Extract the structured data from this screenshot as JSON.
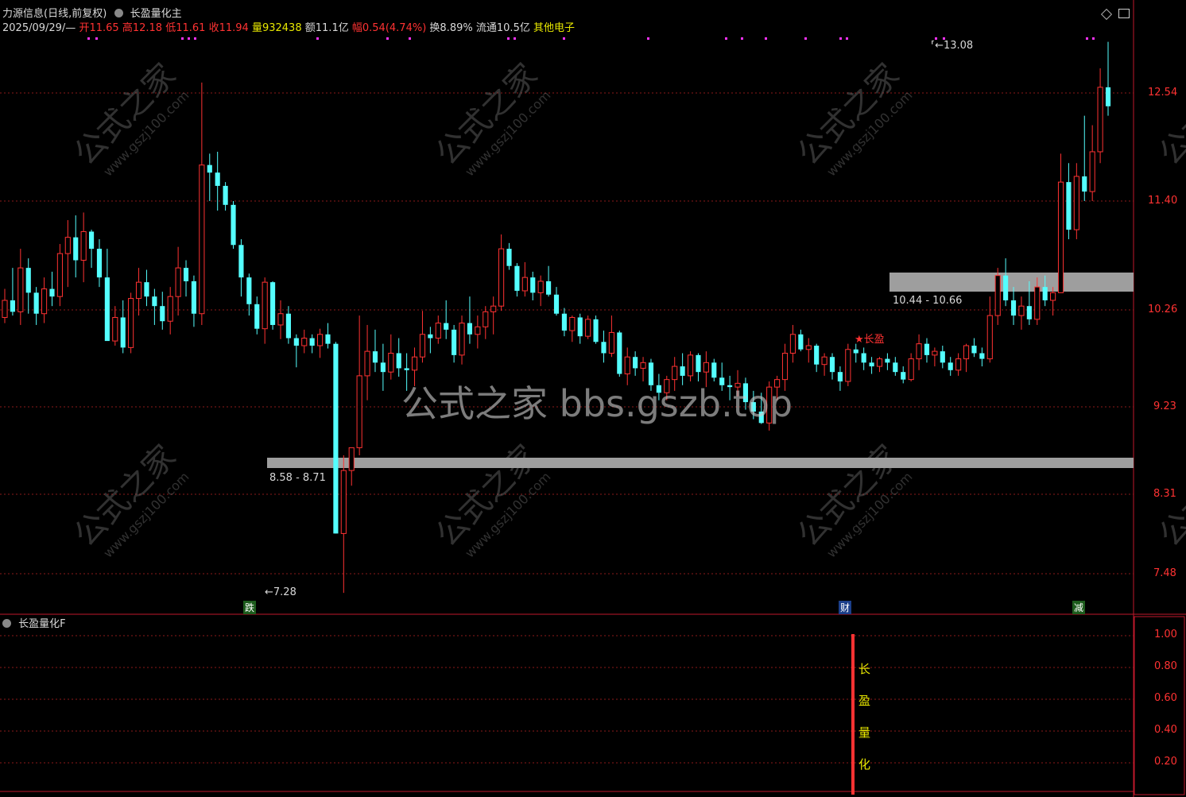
{
  "colors": {
    "up": "#ff3232",
    "down": "#54ffff",
    "grid": "#8b1a1a",
    "frame": "#c0192b",
    "zone": "#9e9e9e",
    "marker": "#ff33ff",
    "text_white": "#d8d8d8",
    "text_yellow": "#e8e800",
    "text_red": "#ff3232",
    "text_pink": "#ff5f87"
  },
  "header": {
    "title": "力源信息(日线,前复权)",
    "indicator_name": "长盈量化主",
    "date": "2025/09/29/—",
    "open_label": "开",
    "open_value": "11.65",
    "high_label": "高",
    "high_value": "12.18",
    "low_label": "低",
    "low_value": "11.61",
    "close_label": "收",
    "close_value": "11.94",
    "volume_label": "量",
    "volume_value": "932438",
    "amount_label": "额",
    "amount_value": "11.1亿",
    "change_label": "幅",
    "change_value": "0.54(4.74%)",
    "turnover_label": "换",
    "turnover_value": "8.89%",
    "float_label": "流通",
    "float_value": "10.5亿",
    "sector": "其他电子"
  },
  "top_icons": {
    "diamond": "diamond-icon",
    "window": "window-icon"
  },
  "price_axis": [
    "12.54",
    "11.40",
    "10.26",
    "9.23",
    "8.31",
    "7.48"
  ],
  "zones": [
    {
      "label": "10.44 - 10.66"
    },
    {
      "label": "8.58 - 8.71"
    }
  ],
  "annotations": {
    "high_mark": "13.08",
    "low_mark": "7.28",
    "signal_star": "★长盈"
  },
  "event_tags": {
    "fall": "跌",
    "finance": "财",
    "reduce": "减"
  },
  "watermarks": {
    "center": "公式之家 bbs.gszb.top",
    "tile_main": "公式之家",
    "tile_sub": "www.gszj100.com"
  },
  "sub_panel": {
    "title": "长盈量化F",
    "vertical_text": [
      "长",
      "盈",
      "量",
      "化"
    ],
    "axis": [
      "1.00",
      "0.80",
      "0.60",
      "0.40",
      "0.20"
    ]
  },
  "chart_data": {
    "type": "candlestick",
    "title": "",
    "ylim": [
      7.0,
      13.7
    ],
    "x_count": 141,
    "candles": [
      [
        10.18,
        10.48,
        10.12,
        10.36
      ],
      [
        10.36,
        10.7,
        10.2,
        10.24
      ],
      [
        10.24,
        10.9,
        10.1,
        10.7
      ],
      [
        10.7,
        10.8,
        10.22,
        10.44
      ],
      [
        10.44,
        10.5,
        10.1,
        10.22
      ],
      [
        10.22,
        10.6,
        10.12,
        10.48
      ],
      [
        10.48,
        10.66,
        10.3,
        10.4
      ],
      [
        10.4,
        10.95,
        10.3,
        10.85
      ],
      [
        10.85,
        11.2,
        10.5,
        11.02
      ],
      [
        11.02,
        11.25,
        10.6,
        10.78
      ],
      [
        10.78,
        11.28,
        10.55,
        11.08
      ],
      [
        11.08,
        11.1,
        10.7,
        10.9
      ],
      [
        10.9,
        11.0,
        10.5,
        10.6
      ],
      [
        10.6,
        10.9,
        9.95,
        9.93
      ],
      [
        9.93,
        10.3,
        9.88,
        10.18
      ],
      [
        10.18,
        10.36,
        9.8,
        9.86
      ],
      [
        9.86,
        10.44,
        9.8,
        10.38
      ],
      [
        10.38,
        10.7,
        10.2,
        10.55
      ],
      [
        10.55,
        10.68,
        10.3,
        10.4
      ],
      [
        10.4,
        10.48,
        10.1,
        10.3
      ],
      [
        10.3,
        10.45,
        10.05,
        10.14
      ],
      [
        10.14,
        10.5,
        10.0,
        10.4
      ],
      [
        10.4,
        10.92,
        10.2,
        10.7
      ],
      [
        10.7,
        10.78,
        10.4,
        10.56
      ],
      [
        10.56,
        10.62,
        10.08,
        10.22
      ],
      [
        10.22,
        12.65,
        10.1,
        11.78
      ],
      [
        11.78,
        11.9,
        11.4,
        11.7
      ],
      [
        11.7,
        11.92,
        11.3,
        11.56
      ],
      [
        11.56,
        11.6,
        11.3,
        11.36
      ],
      [
        11.36,
        11.4,
        10.9,
        10.94
      ],
      [
        10.94,
        11.0,
        10.4,
        10.6
      ],
      [
        10.6,
        10.64,
        10.2,
        10.32
      ],
      [
        10.32,
        10.4,
        10.0,
        10.06
      ],
      [
        10.06,
        10.6,
        9.9,
        10.55
      ],
      [
        10.55,
        10.56,
        10.05,
        10.1
      ],
      [
        10.1,
        10.36,
        9.95,
        10.22
      ],
      [
        10.22,
        10.3,
        9.9,
        9.96
      ],
      [
        9.96,
        10.0,
        9.65,
        9.88
      ],
      [
        9.88,
        10.05,
        9.8,
        9.96
      ],
      [
        9.96,
        10.0,
        9.8,
        9.88
      ],
      [
        9.88,
        10.06,
        9.75,
        10.0
      ],
      [
        10.0,
        10.12,
        9.85,
        9.9
      ],
      [
        9.9,
        9.92,
        7.9,
        7.9
      ],
      [
        7.9,
        8.72,
        7.28,
        8.56
      ],
      [
        8.56,
        8.8,
        8.4,
        8.8
      ],
      [
        8.8,
        10.2,
        8.72,
        9.56
      ],
      [
        9.56,
        10.1,
        9.3,
        9.82
      ],
      [
        9.82,
        10.05,
        9.6,
        9.7
      ],
      [
        9.7,
        9.9,
        9.4,
        9.6
      ],
      [
        9.6,
        10.0,
        9.52,
        9.8
      ],
      [
        9.8,
        9.96,
        9.55,
        9.64
      ],
      [
        9.64,
        9.8,
        9.4,
        9.62
      ],
      [
        9.62,
        9.86,
        9.45,
        9.76
      ],
      [
        9.76,
        10.25,
        9.7,
        10.0
      ],
      [
        10.0,
        10.08,
        9.8,
        9.96
      ],
      [
        9.96,
        10.2,
        9.9,
        10.12
      ],
      [
        10.12,
        10.36,
        9.95,
        10.05
      ],
      [
        10.05,
        10.1,
        9.7,
        9.78
      ],
      [
        9.78,
        10.2,
        9.68,
        10.12
      ],
      [
        10.12,
        10.4,
        9.9,
        10.0
      ],
      [
        10.0,
        10.2,
        9.85,
        10.08
      ],
      [
        10.08,
        10.3,
        9.95,
        10.24
      ],
      [
        10.24,
        10.4,
        10.0,
        10.3
      ],
      [
        10.3,
        11.05,
        10.25,
        10.9
      ],
      [
        10.9,
        10.96,
        10.68,
        10.72
      ],
      [
        10.72,
        10.75,
        10.4,
        10.46
      ],
      [
        10.46,
        10.76,
        10.4,
        10.6
      ],
      [
        10.6,
        10.66,
        10.36,
        10.44
      ],
      [
        10.44,
        10.62,
        10.3,
        10.56
      ],
      [
        10.56,
        10.72,
        10.4,
        10.42
      ],
      [
        10.42,
        10.5,
        10.2,
        10.22
      ],
      [
        10.22,
        10.28,
        9.98,
        10.04
      ],
      [
        10.04,
        10.2,
        9.92,
        10.18
      ],
      [
        10.18,
        10.22,
        9.9,
        9.98
      ],
      [
        9.98,
        10.2,
        9.95,
        10.16
      ],
      [
        10.16,
        10.2,
        9.9,
        9.92
      ],
      [
        9.92,
        10.04,
        9.7,
        9.8
      ],
      [
        9.8,
        10.2,
        9.76,
        10.02
      ],
      [
        10.02,
        10.04,
        9.55,
        9.58
      ],
      [
        9.58,
        9.86,
        9.46,
        9.76
      ],
      [
        9.76,
        9.82,
        9.56,
        9.64
      ],
      [
        9.64,
        9.76,
        9.5,
        9.7
      ],
      [
        9.7,
        9.74,
        9.4,
        9.46
      ],
      [
        9.46,
        9.58,
        9.3,
        9.38
      ],
      [
        9.38,
        9.56,
        9.3,
        9.52
      ],
      [
        9.52,
        9.76,
        9.4,
        9.66
      ],
      [
        9.66,
        9.8,
        9.46,
        9.56
      ],
      [
        9.56,
        9.82,
        9.5,
        9.78
      ],
      [
        9.78,
        9.8,
        9.5,
        9.6
      ],
      [
        9.6,
        9.82,
        9.44,
        9.7
      ],
      [
        9.7,
        9.74,
        9.5,
        9.54
      ],
      [
        9.54,
        9.7,
        9.4,
        9.46
      ],
      [
        9.46,
        9.56,
        9.3,
        9.44
      ],
      [
        9.44,
        9.62,
        9.34,
        9.48
      ],
      [
        9.48,
        9.54,
        9.2,
        9.28
      ],
      [
        9.28,
        9.4,
        9.1,
        9.18
      ],
      [
        9.18,
        9.38,
        9.05,
        9.06
      ],
      [
        9.06,
        9.5,
        8.98,
        9.44
      ],
      [
        9.44,
        9.56,
        9.3,
        9.52
      ],
      [
        9.52,
        9.9,
        9.4,
        9.8
      ],
      [
        9.8,
        10.1,
        9.7,
        10.0
      ],
      [
        10.0,
        10.05,
        9.82,
        9.84
      ],
      [
        9.84,
        9.96,
        9.7,
        9.88
      ],
      [
        9.88,
        9.9,
        9.6,
        9.68
      ],
      [
        9.68,
        9.8,
        9.56,
        9.76
      ],
      [
        9.76,
        9.8,
        9.52,
        9.6
      ],
      [
        9.6,
        9.66,
        9.4,
        9.5
      ],
      [
        9.5,
        9.9,
        9.45,
        9.84
      ],
      [
        9.84,
        9.9,
        9.7,
        9.8
      ],
      [
        9.8,
        9.86,
        9.62,
        9.7
      ],
      [
        9.7,
        9.76,
        9.58,
        9.66
      ],
      [
        9.66,
        9.76,
        9.6,
        9.74
      ],
      [
        9.74,
        9.8,
        9.62,
        9.7
      ],
      [
        9.7,
        9.76,
        9.56,
        9.6
      ],
      [
        9.6,
        9.66,
        9.48,
        9.52
      ],
      [
        9.52,
        9.8,
        9.5,
        9.74
      ],
      [
        9.74,
        10.0,
        9.62,
        9.9
      ],
      [
        9.9,
        9.96,
        9.7,
        9.78
      ],
      [
        9.78,
        9.86,
        9.66,
        9.82
      ],
      [
        9.82,
        9.88,
        9.64,
        9.7
      ],
      [
        9.7,
        9.76,
        9.56,
        9.62
      ],
      [
        9.62,
        9.8,
        9.56,
        9.74
      ],
      [
        9.74,
        9.9,
        9.6,
        9.88
      ],
      [
        9.88,
        9.96,
        9.76,
        9.8
      ],
      [
        9.8,
        9.86,
        9.66,
        9.74
      ]
    ]
  }
}
